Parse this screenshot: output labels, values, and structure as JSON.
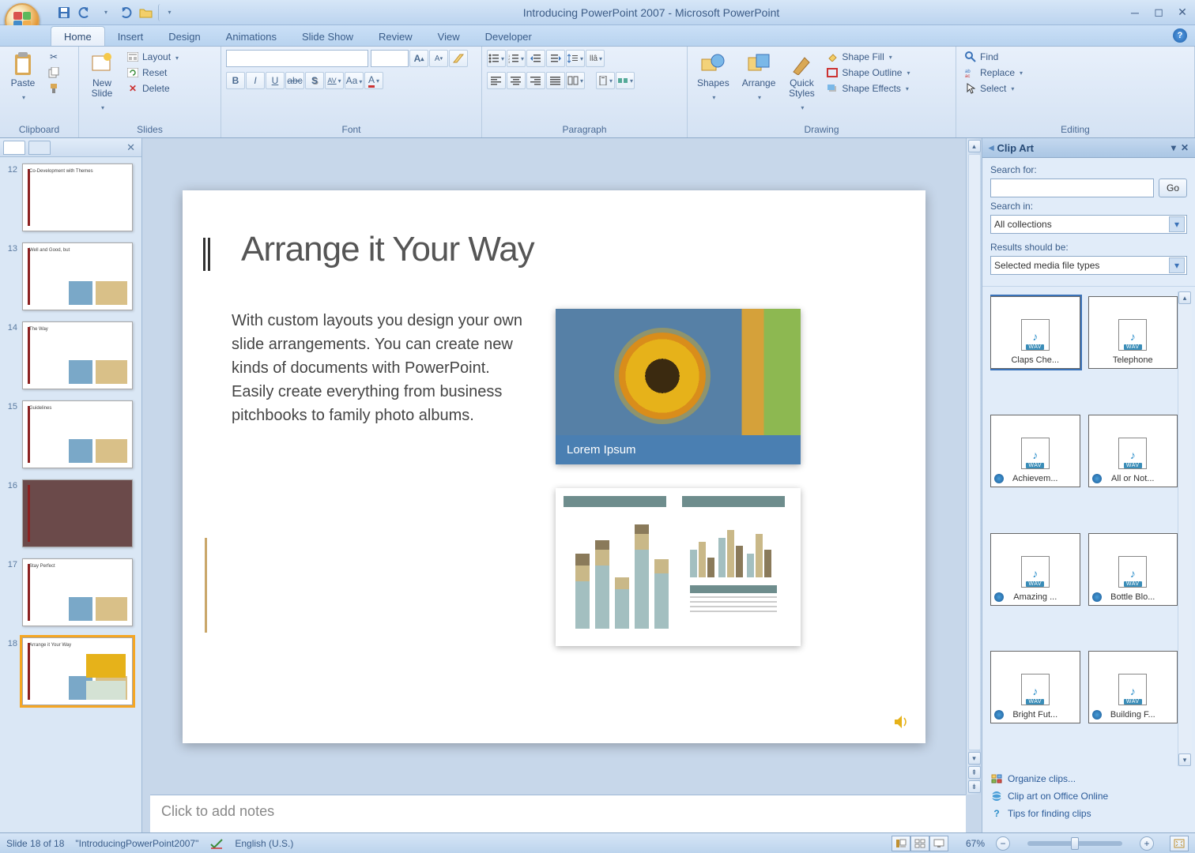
{
  "title": "Introducing PowerPoint 2007 - Microsoft PowerPoint",
  "tabs": [
    "Home",
    "Insert",
    "Design",
    "Animations",
    "Slide Show",
    "Review",
    "View",
    "Developer"
  ],
  "active_tab": "Home",
  "ribbon": {
    "clipboard": {
      "label": "Clipboard",
      "paste": "Paste"
    },
    "slides": {
      "label": "Slides",
      "new_slide": "New\nSlide",
      "layout": "Layout",
      "reset": "Reset",
      "delete": "Delete"
    },
    "font": {
      "label": "Font"
    },
    "paragraph": {
      "label": "Paragraph"
    },
    "drawing": {
      "label": "Drawing",
      "shapes": "Shapes",
      "arrange": "Arrange",
      "quick_styles": "Quick\nStyles",
      "shape_fill": "Shape Fill",
      "shape_outline": "Shape Outline",
      "shape_effects": "Shape Effects"
    },
    "editing": {
      "label": "Editing",
      "find": "Find",
      "replace": "Replace",
      "select": "Select"
    }
  },
  "thumbnails": [
    {
      "num": 12,
      "title": "Co-Development with Themes"
    },
    {
      "num": 13,
      "title": "Well and Good, but"
    },
    {
      "num": 14,
      "title": "The Way"
    },
    {
      "num": 15,
      "title": "Guidelines"
    },
    {
      "num": 16,
      "title": ""
    },
    {
      "num": 17,
      "title": "Stay Perfect"
    },
    {
      "num": 18,
      "title": "Arrange it Your Way"
    }
  ],
  "selected_thumb": 18,
  "slide": {
    "title": "Arrange it Your Way",
    "body": "With custom layouts you design your own slide arrangements. You can create new kinds of documents with PowerPoint. Easily create everything from business pitchbooks to family photo albums.",
    "caption": "Lorem Ipsum"
  },
  "notes_placeholder": "Click to add notes",
  "clipart": {
    "title": "Clip Art",
    "search_for": "Search for:",
    "go": "Go",
    "search_in": "Search in:",
    "search_in_val": "All collections",
    "results_should": "Results should be:",
    "results_val": "Selected media file types",
    "items": [
      "Claps Che...",
      "Telephone",
      "Achievem...",
      "All or Not...",
      "Amazing ...",
      "Bottle Blo...",
      "Bright Fut...",
      "Building F..."
    ],
    "organize": "Organize clips...",
    "online": "Clip art on Office Online",
    "tips": "Tips for finding clips"
  },
  "status": {
    "slide_of": "Slide 18 of 18",
    "filename": "\"IntroducingPowerPoint2007\"",
    "lang": "English (U.S.)",
    "zoom": "67%"
  }
}
